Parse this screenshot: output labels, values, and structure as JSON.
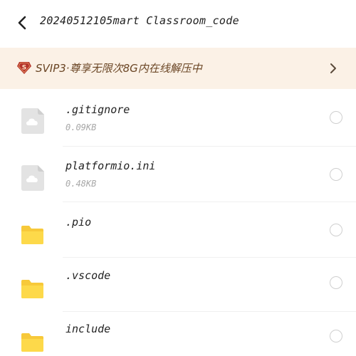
{
  "header": {
    "title": "20240512105mart Classroom_code",
    "back_icon": "chevron-left-icon"
  },
  "vip_banner": {
    "badge": "S",
    "text": "SVIP3·尊享无限次8G内在线解压中",
    "icon": "chevron-right-icon"
  },
  "files": [
    {
      "name": ".gitignore",
      "size": "0.09KB",
      "type": "file",
      "icon": "cloud-file-icon"
    },
    {
      "name": "platformio.ini",
      "size": "0.48KB",
      "type": "file",
      "icon": "cloud-file-icon"
    },
    {
      "name": ".pio",
      "size": "",
      "type": "folder",
      "icon": "folder-icon"
    },
    {
      "name": ".vscode",
      "size": "",
      "type": "folder",
      "icon": "folder-icon"
    },
    {
      "name": "include",
      "size": "",
      "type": "folder",
      "icon": "folder-icon"
    }
  ],
  "colors": {
    "banner_bg": "#fbf1e6",
    "banner_text": "#6a4524",
    "badge": "#b5342b",
    "folder": "#fdd94a",
    "file_icon": "#e3e3e3"
  }
}
